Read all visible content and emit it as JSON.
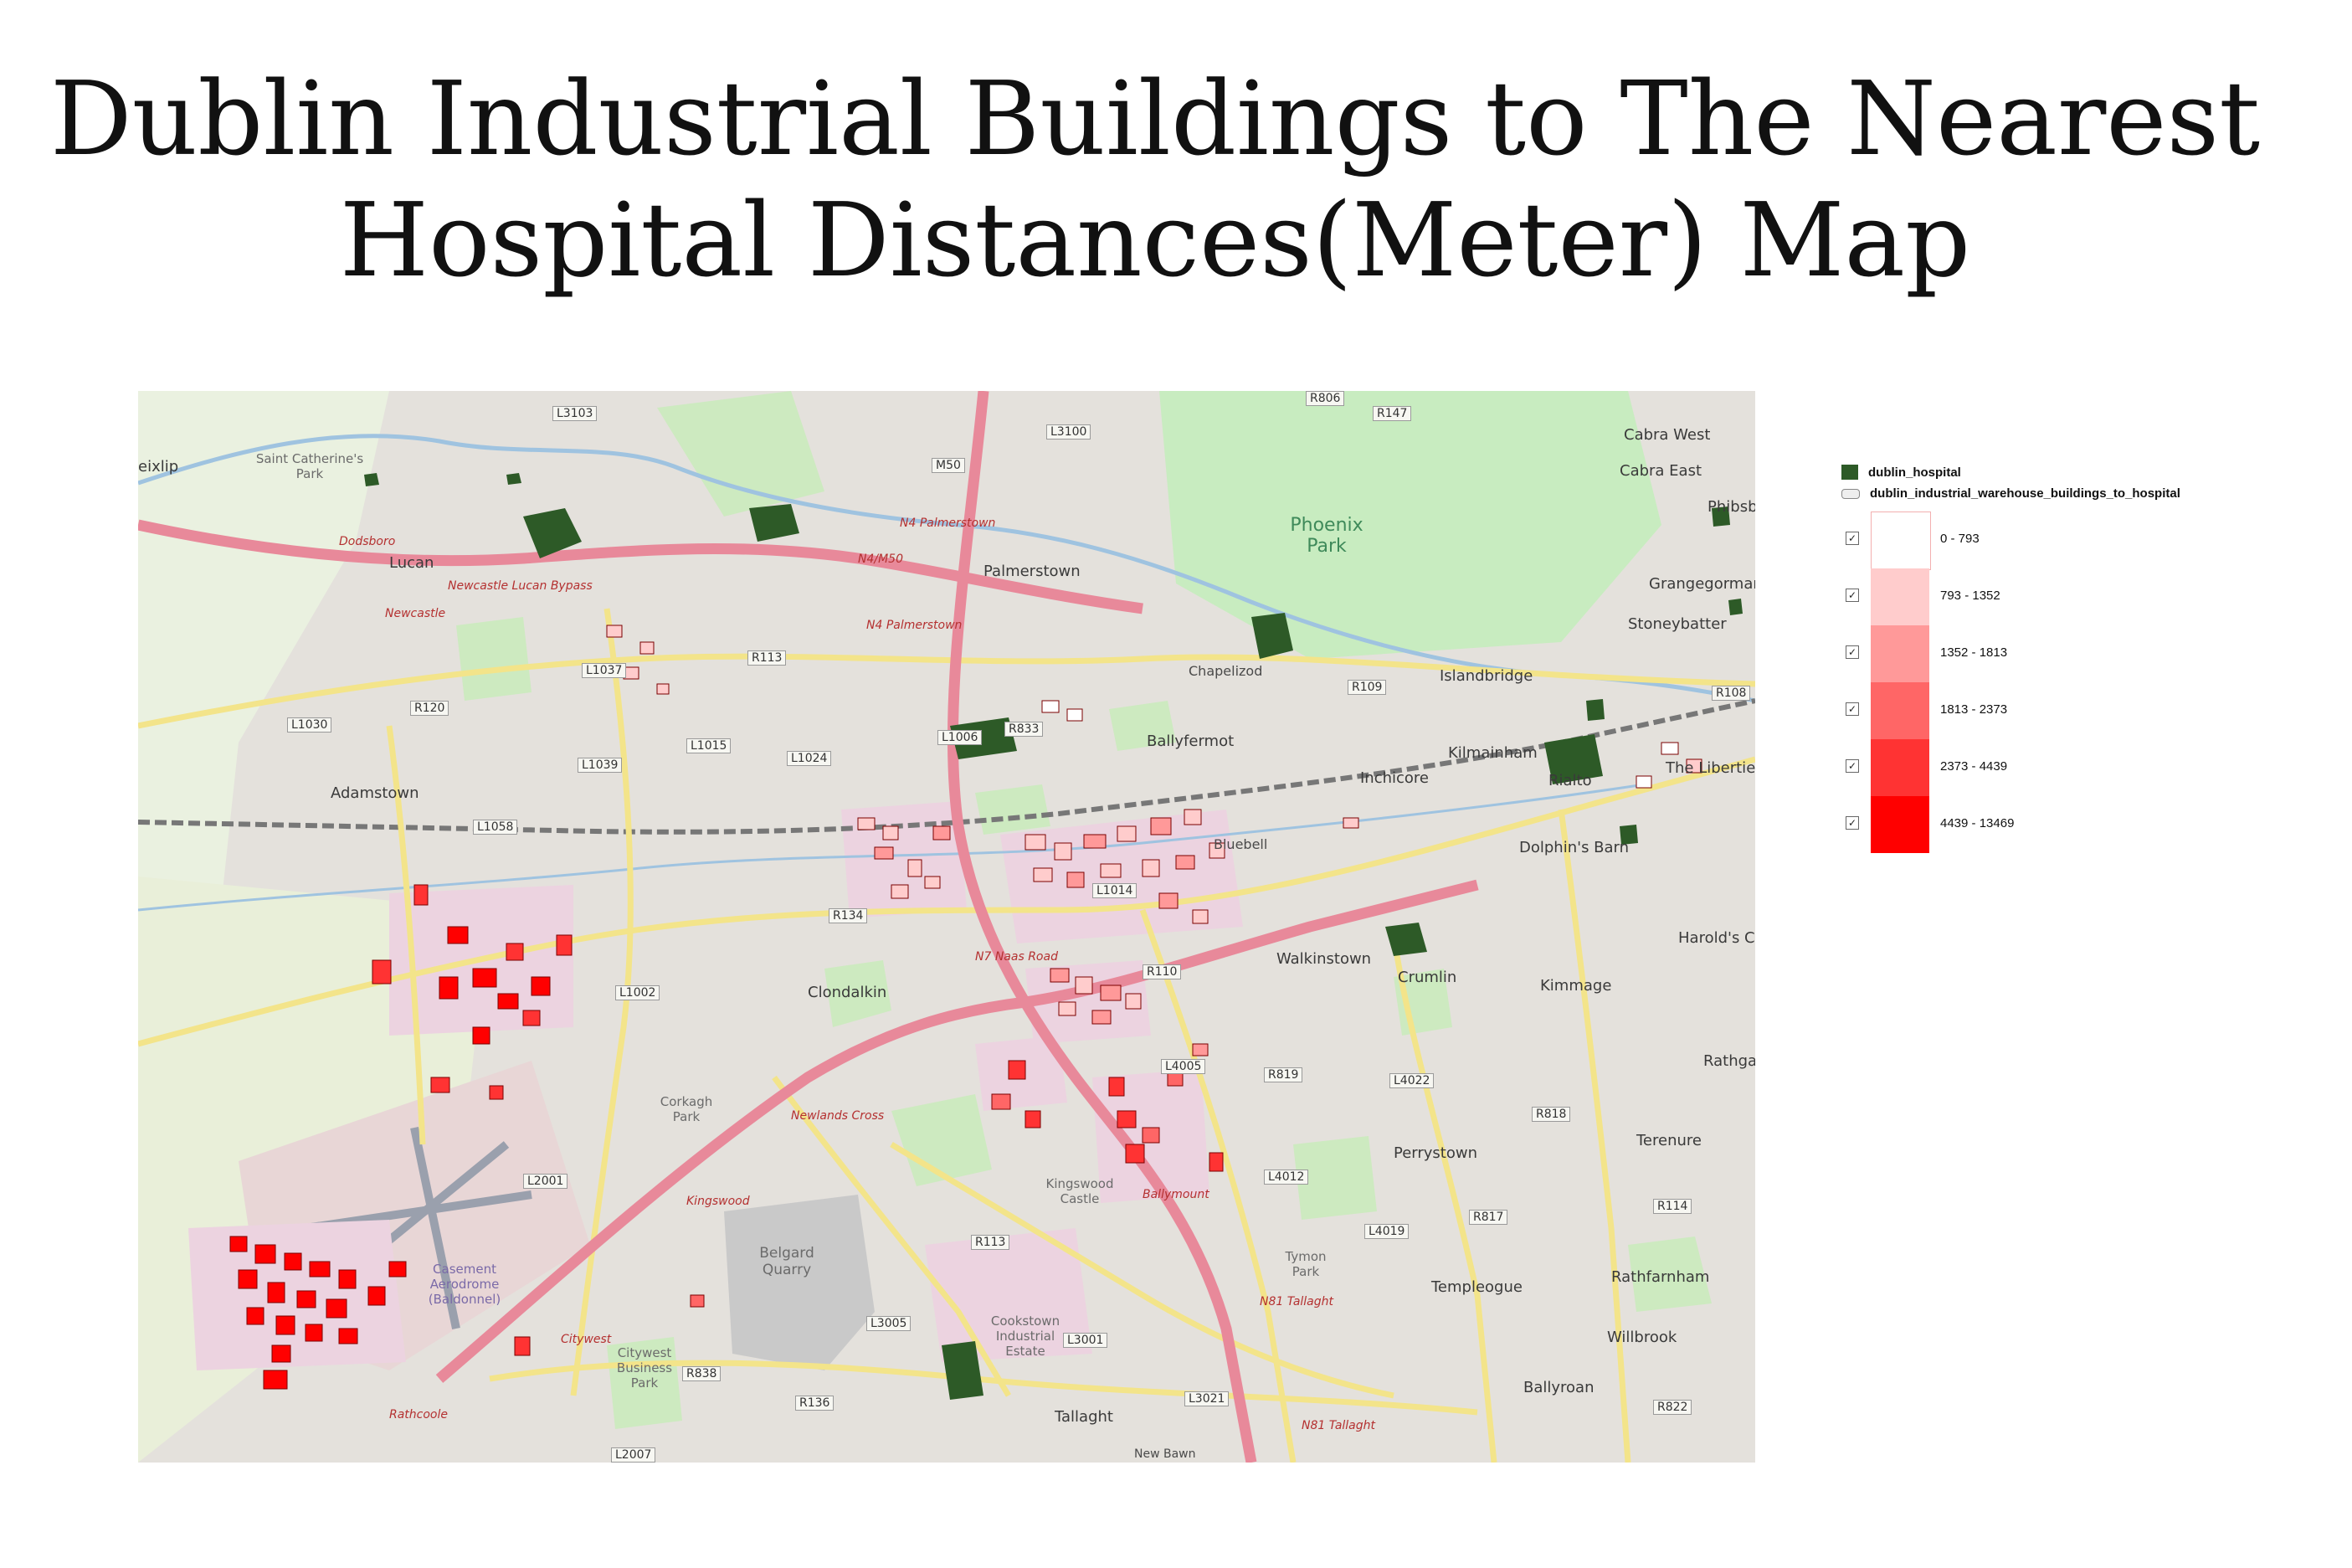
{
  "title": {
    "line1": "Dublin Industrial Buildings to The Nearest",
    "line2": "Hospital Distances(Meter) Map"
  },
  "legend": {
    "hospital_layer": "dublin_hospital",
    "hospital_color": "#2d5a27",
    "buildings_layer": "dublin_industrial_warehouse_buildings_to_hospital",
    "classes": [
      {
        "label": "0 - 793",
        "color": "#ffffff",
        "checked": true
      },
      {
        "label": "793 - 1352",
        "color": "#ffcccc",
        "checked": true
      },
      {
        "label": "1352 - 1813",
        "color": "#ff9999",
        "checked": true
      },
      {
        "label": "1813 - 2373",
        "color": "#ff6666",
        "checked": true
      },
      {
        "label": "2373 - 4439",
        "color": "#ff3333",
        "checked": true
      },
      {
        "label": "4439 - 13469",
        "color": "#ff0000",
        "checked": true
      }
    ]
  },
  "map": {
    "places": {
      "leixlip": "eixlip",
      "st_catherines": "Saint Catherine's Park",
      "lucan": "Lucan",
      "dodsboro": "Dodsboro",
      "adamstown": "Adamstown",
      "clondalkin": "Clondalkin",
      "palmerstown": "Palmerstown",
      "chapelizod": "Chapelizod",
      "ballyfermot": "Ballyfermot",
      "inchicore": "Inchicore",
      "kilmainham": "Kilmainham",
      "islandbridge": "Islandbridge",
      "phoenix_park": "Phoenix Park",
      "cabra_west": "Cabra West",
      "cabra_east": "Cabra East",
      "phibsb": "Phibsb",
      "grangegorman": "Grangegorman",
      "stoneybatter": "Stoneybatter",
      "the_liberties": "The Liberties",
      "rialto": "Rialto",
      "dolphins_barn": "Dolphin's Barn",
      "harolds_cross": "Harold's Cros",
      "walkinstown": "Walkinstown",
      "crumlin": "Crumlin",
      "kimmage": "Kimmage",
      "rathgar": "Rathga",
      "terenure": "Terenure",
      "perrystown": "Perrystown",
      "templeogue": "Templeogue",
      "rathfarnham": "Rathfarnham",
      "willbrook": "Willbrook",
      "ballyroan": "Ballyroan",
      "tallaght": "Tallaght",
      "kingswood_castle": "Kingswood Castle",
      "belgard_quarry": "Belgard Quarry",
      "cookstown": "Cookstown Industrial Estate",
      "citywest": "Citywest Business Park",
      "casement": "Casement Aerodrome (Baldonnel)",
      "rathcoole": "Rathcoole",
      "corkagh_park": "Corkagh Park",
      "kingswood": "Kingswood",
      "newcastle": "Newcastle",
      "tymon_park": "Tymon Park",
      "bluebell": "Bluebell",
      "new_bawn": "New Bawn"
    },
    "roads": [
      "L3103",
      "L3100",
      "M50",
      "R806",
      "R147",
      "R113",
      "L1037",
      "L1015",
      "L1024",
      "L1039",
      "L1030",
      "R120",
      "L1058",
      "L1006",
      "R833",
      "R109",
      "R108",
      "R134",
      "L1014",
      "R110",
      "L1002",
      "L4005",
      "R819",
      "L4022",
      "R818",
      "L4012",
      "L4019",
      "R817",
      "R114",
      "L2001",
      "R113",
      "L3005",
      "L3001",
      "R838",
      "R136",
      "L3021",
      "R822",
      "L2007"
    ],
    "red_roads": {
      "n4_palmerstown": "N4 Palmerstown",
      "n4_m50": "N4/M50",
      "n4_palmerstown_2": "N4 Palmerstown",
      "newcastle_bypass": "Newcastle Lucan Bypass",
      "n7_naas": "N7 Naas Road",
      "newlands_cross": "Newlands Cross",
      "kingswood": "Kingswood",
      "ballymount": "Ballymount",
      "n81_tallaght": "N81 Tallaght",
      "n81_tallaght_2": "N81 Tallaght",
      "citywest": "Citywest"
    }
  }
}
